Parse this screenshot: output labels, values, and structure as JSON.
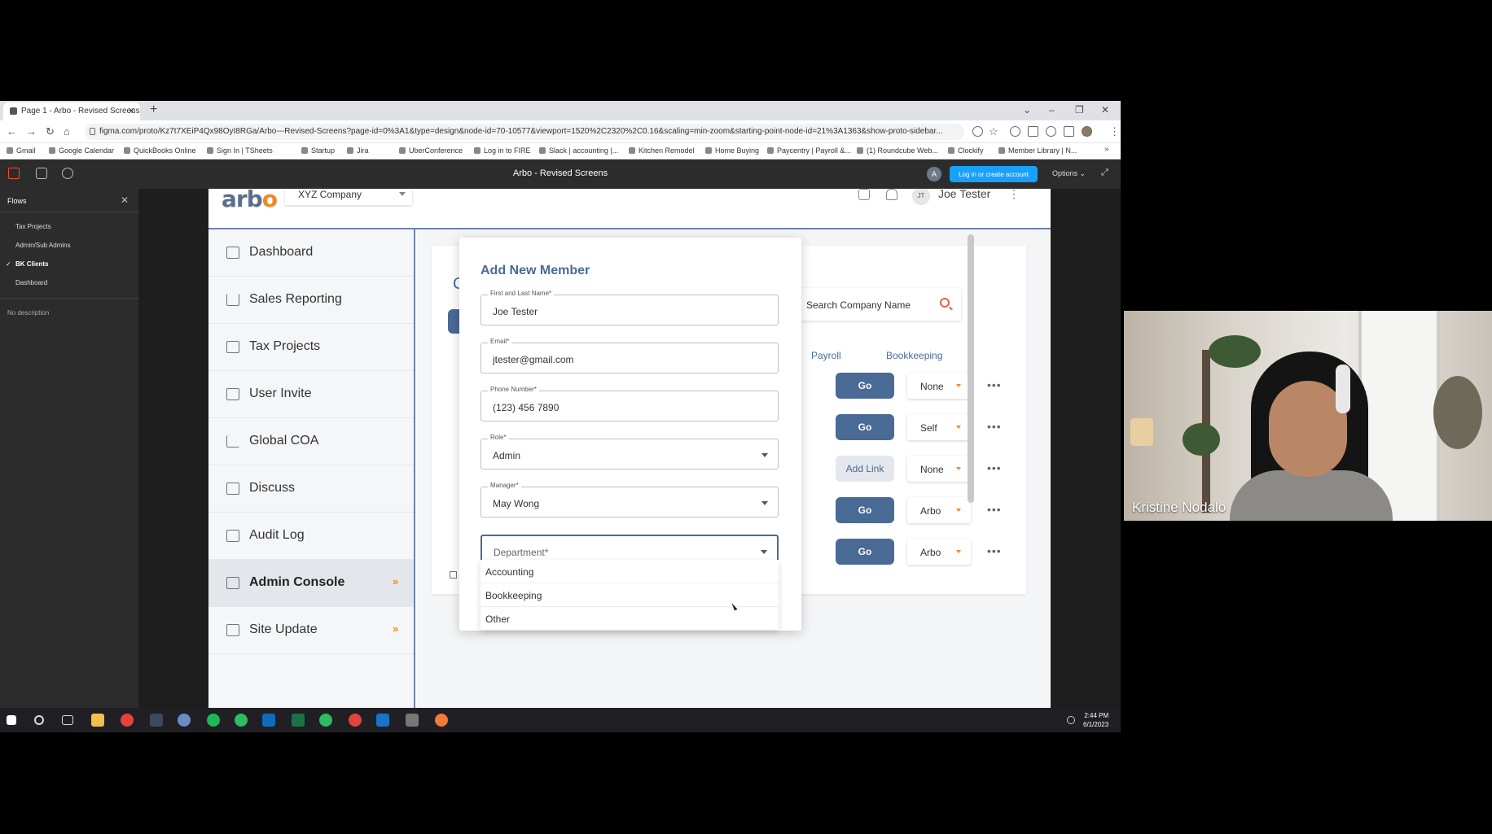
{
  "browser": {
    "tab_title": "Page 1 - Arbo - Revised Screens",
    "url": "figma.com/proto/Kz7t7XEiP4Qx98OyI8RGa/Arbo---Revised-Screens?page-id=0%3A1&type=design&node-id=70-10577&viewport=1520%2C2320%2C0.16&scaling=min-zoom&starting-point-node-id=21%3A1363&show-proto-sidebar...",
    "bookmarks": [
      "Gmail",
      "Google Calendar",
      "QuickBooks Online",
      "Sign In | TSheets",
      "Startup",
      "Jira",
      "UberConference",
      "Log in to FIRE",
      "Slack | accounting |...",
      "Kitchen Remodel",
      "Home Buying",
      "Paycentry | Payroll &...",
      "(1) Roundcube Web...",
      "Clockify",
      "Member Library | N..."
    ]
  },
  "figma": {
    "file_title": "Arbo - Revised Screens",
    "avatar_letter": "A",
    "login_button": "Log in or create account",
    "options_label": "Options ⌄"
  },
  "flows": {
    "header": "Flows",
    "items": [
      "Tax Projects",
      "Admin/Sub Admins",
      "BK Clients",
      "Dashboard"
    ],
    "active_index": 2,
    "description": "No description"
  },
  "app": {
    "logo_text": "arb",
    "logo_accent": "o",
    "company": "XYZ Company",
    "user_initials": "JT",
    "user_name": "Joe Tester",
    "accent": "#4a6a96",
    "brand_orange": "#f08a24"
  },
  "sidebar": {
    "items": [
      {
        "label": "Dashboard",
        "icon": "archive-icon"
      },
      {
        "label": "Sales Reporting",
        "icon": "bar-chart-icon"
      },
      {
        "label": "Tax Projects",
        "icon": "card-icon"
      },
      {
        "label": "User Invite",
        "icon": "chat-icon"
      },
      {
        "label": "Global COA",
        "icon": "line-chart-icon"
      },
      {
        "label": "Discuss",
        "icon": "document-icon"
      },
      {
        "label": "Audit Log",
        "icon": "ledger-icon"
      },
      {
        "label": "Admin Console",
        "icon": "console-icon",
        "chevron": "»"
      },
      {
        "label": "Site Update",
        "icon": "grid-icon",
        "chevron": "»"
      }
    ],
    "active_index": 7
  },
  "content": {
    "bg_letter": "C",
    "search_placeholder": "Search Company Name",
    "columns": {
      "payroll": "Payroll",
      "bookkeeping": "Bookkeeping"
    },
    "rows": [
      {
        "action": "Go",
        "bookkeeping": "None"
      },
      {
        "action": "Go",
        "bookkeeping": "Self"
      },
      {
        "action": "Add Link",
        "bookkeeping": "None"
      },
      {
        "action": "Go",
        "bookkeeping": "Arbo"
      },
      {
        "action": "Go",
        "bookkeeping": "Arbo"
      }
    ],
    "more_glyph": "•••"
  },
  "modal": {
    "title": "Add New Member",
    "fields": [
      {
        "label": "First and Last Name*",
        "value": "Joe Tester"
      },
      {
        "label": "Email*",
        "value": "jtester@gmail.com"
      },
      {
        "label": "Phone Number*",
        "value": "(123) 456 7890"
      },
      {
        "label": "Role*",
        "value": "Admin"
      },
      {
        "label": "Manager*",
        "value": "May Wong"
      }
    ],
    "department_placeholder": "Department*",
    "department_options": [
      "Accounting",
      "Bookkeeping",
      "Other"
    ]
  },
  "taskbar": {
    "time": "2:44 PM",
    "date": "6/1/2023"
  },
  "webcam": {
    "participant_name": "Kristine Nodalo"
  }
}
